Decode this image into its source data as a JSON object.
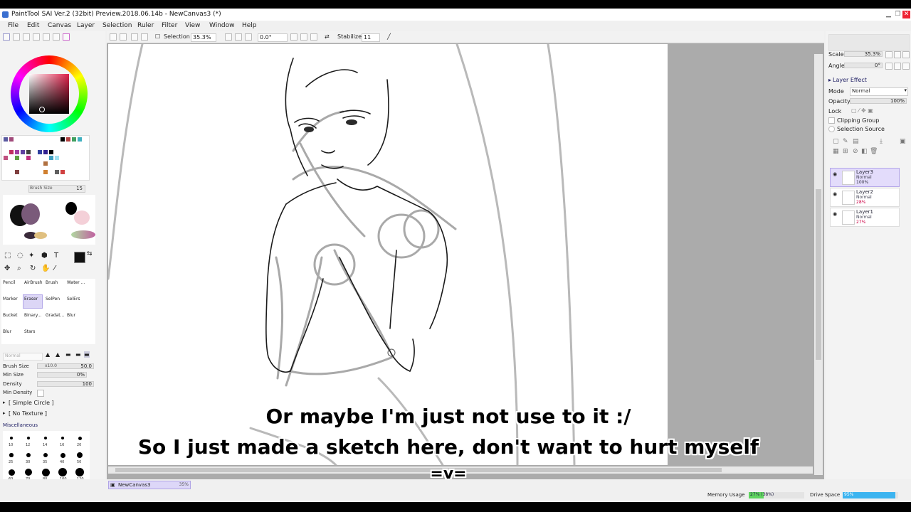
{
  "window": {
    "title": "PaintTool SAI Ver.2 (32bit) Preview.2018.06.14b - NewCanvas3 (*)"
  },
  "menu": [
    "File",
    "Edit",
    "Canvas",
    "Layer",
    "Selection",
    "Ruler",
    "Filter",
    "View",
    "Window",
    "Help"
  ],
  "toolbar": {
    "selection_label": "Selection",
    "zoom": "35.3%",
    "rotation": "0.0°",
    "stabilizer_label": "Stabilizer",
    "stabilizer_value": "11"
  },
  "left": {
    "brush_size_small_label": "Brush Size",
    "brush_size_small_value": "15",
    "tools": [
      [
        "Pencil",
        "AirBrush",
        "Brush",
        "Water ..."
      ],
      [
        "Marker",
        "Eraser",
        "SelPen",
        "SelErs"
      ],
      [
        "Bucket",
        "Binary...",
        "Gradat...",
        "Blur"
      ],
      [
        "Blur",
        "Stars"
      ]
    ],
    "blend_mode": "Normal",
    "brush_size_label": "Brush Size",
    "brush_size_mult": "x10.0",
    "brush_size_value": "50.0",
    "min_size_label": "Min Size",
    "min_size_value": "0%",
    "density_label": "Density",
    "density_value": "100",
    "min_density_label": "Min Density",
    "shape": "[ Simple Circle ]",
    "texture": "[ No Texture ]",
    "misc_label": "Miscellaneous",
    "brush_sizes": [
      "10",
      "12",
      "14",
      "16",
      "20",
      "25",
      "30",
      "35",
      "40",
      "50",
      "60",
      "70",
      "80",
      "100",
      "120"
    ]
  },
  "right": {
    "scale_label": "Scale",
    "scale_value": "35.3%",
    "angle_label": "Angle",
    "angle_value": "0°",
    "layer_effect_label": "Layer Effect",
    "mode_label": "Mode",
    "mode_value": "Normal",
    "opacity_label": "Opacity",
    "opacity_value": "100%",
    "lock_label": "Lock",
    "clipping_label": "Clipping Group",
    "selection_source_label": "Selection Source",
    "layers": [
      {
        "name": "Layer3",
        "mode": "Normal",
        "opacity": "100%",
        "selected": true
      },
      {
        "name": "Layer2",
        "mode": "Normal",
        "opacity": "28%",
        "selected": false
      },
      {
        "name": "Layer1",
        "mode": "Normal",
        "opacity": "27%",
        "selected": false
      }
    ]
  },
  "status": {
    "canvas_tab_name": "NewCanvas3",
    "canvas_tab_zoom": "35%",
    "memory_label": "Memory Usage",
    "memory_value": "27% (38%)",
    "memory_fraction": 0.27,
    "drive_label": "Drive Space",
    "drive_value": "95%",
    "drive_fraction": 0.95
  },
  "captions": [
    "Or maybe I'm just not use to it :/",
    "So I just made a sketch here, don't want to hurt myself",
    "=v="
  ],
  "colors": {
    "accent_selected_layer": "#e3dcfb",
    "memory_bar": "#5fd45f",
    "drive_bar": "#3cb4f0"
  }
}
